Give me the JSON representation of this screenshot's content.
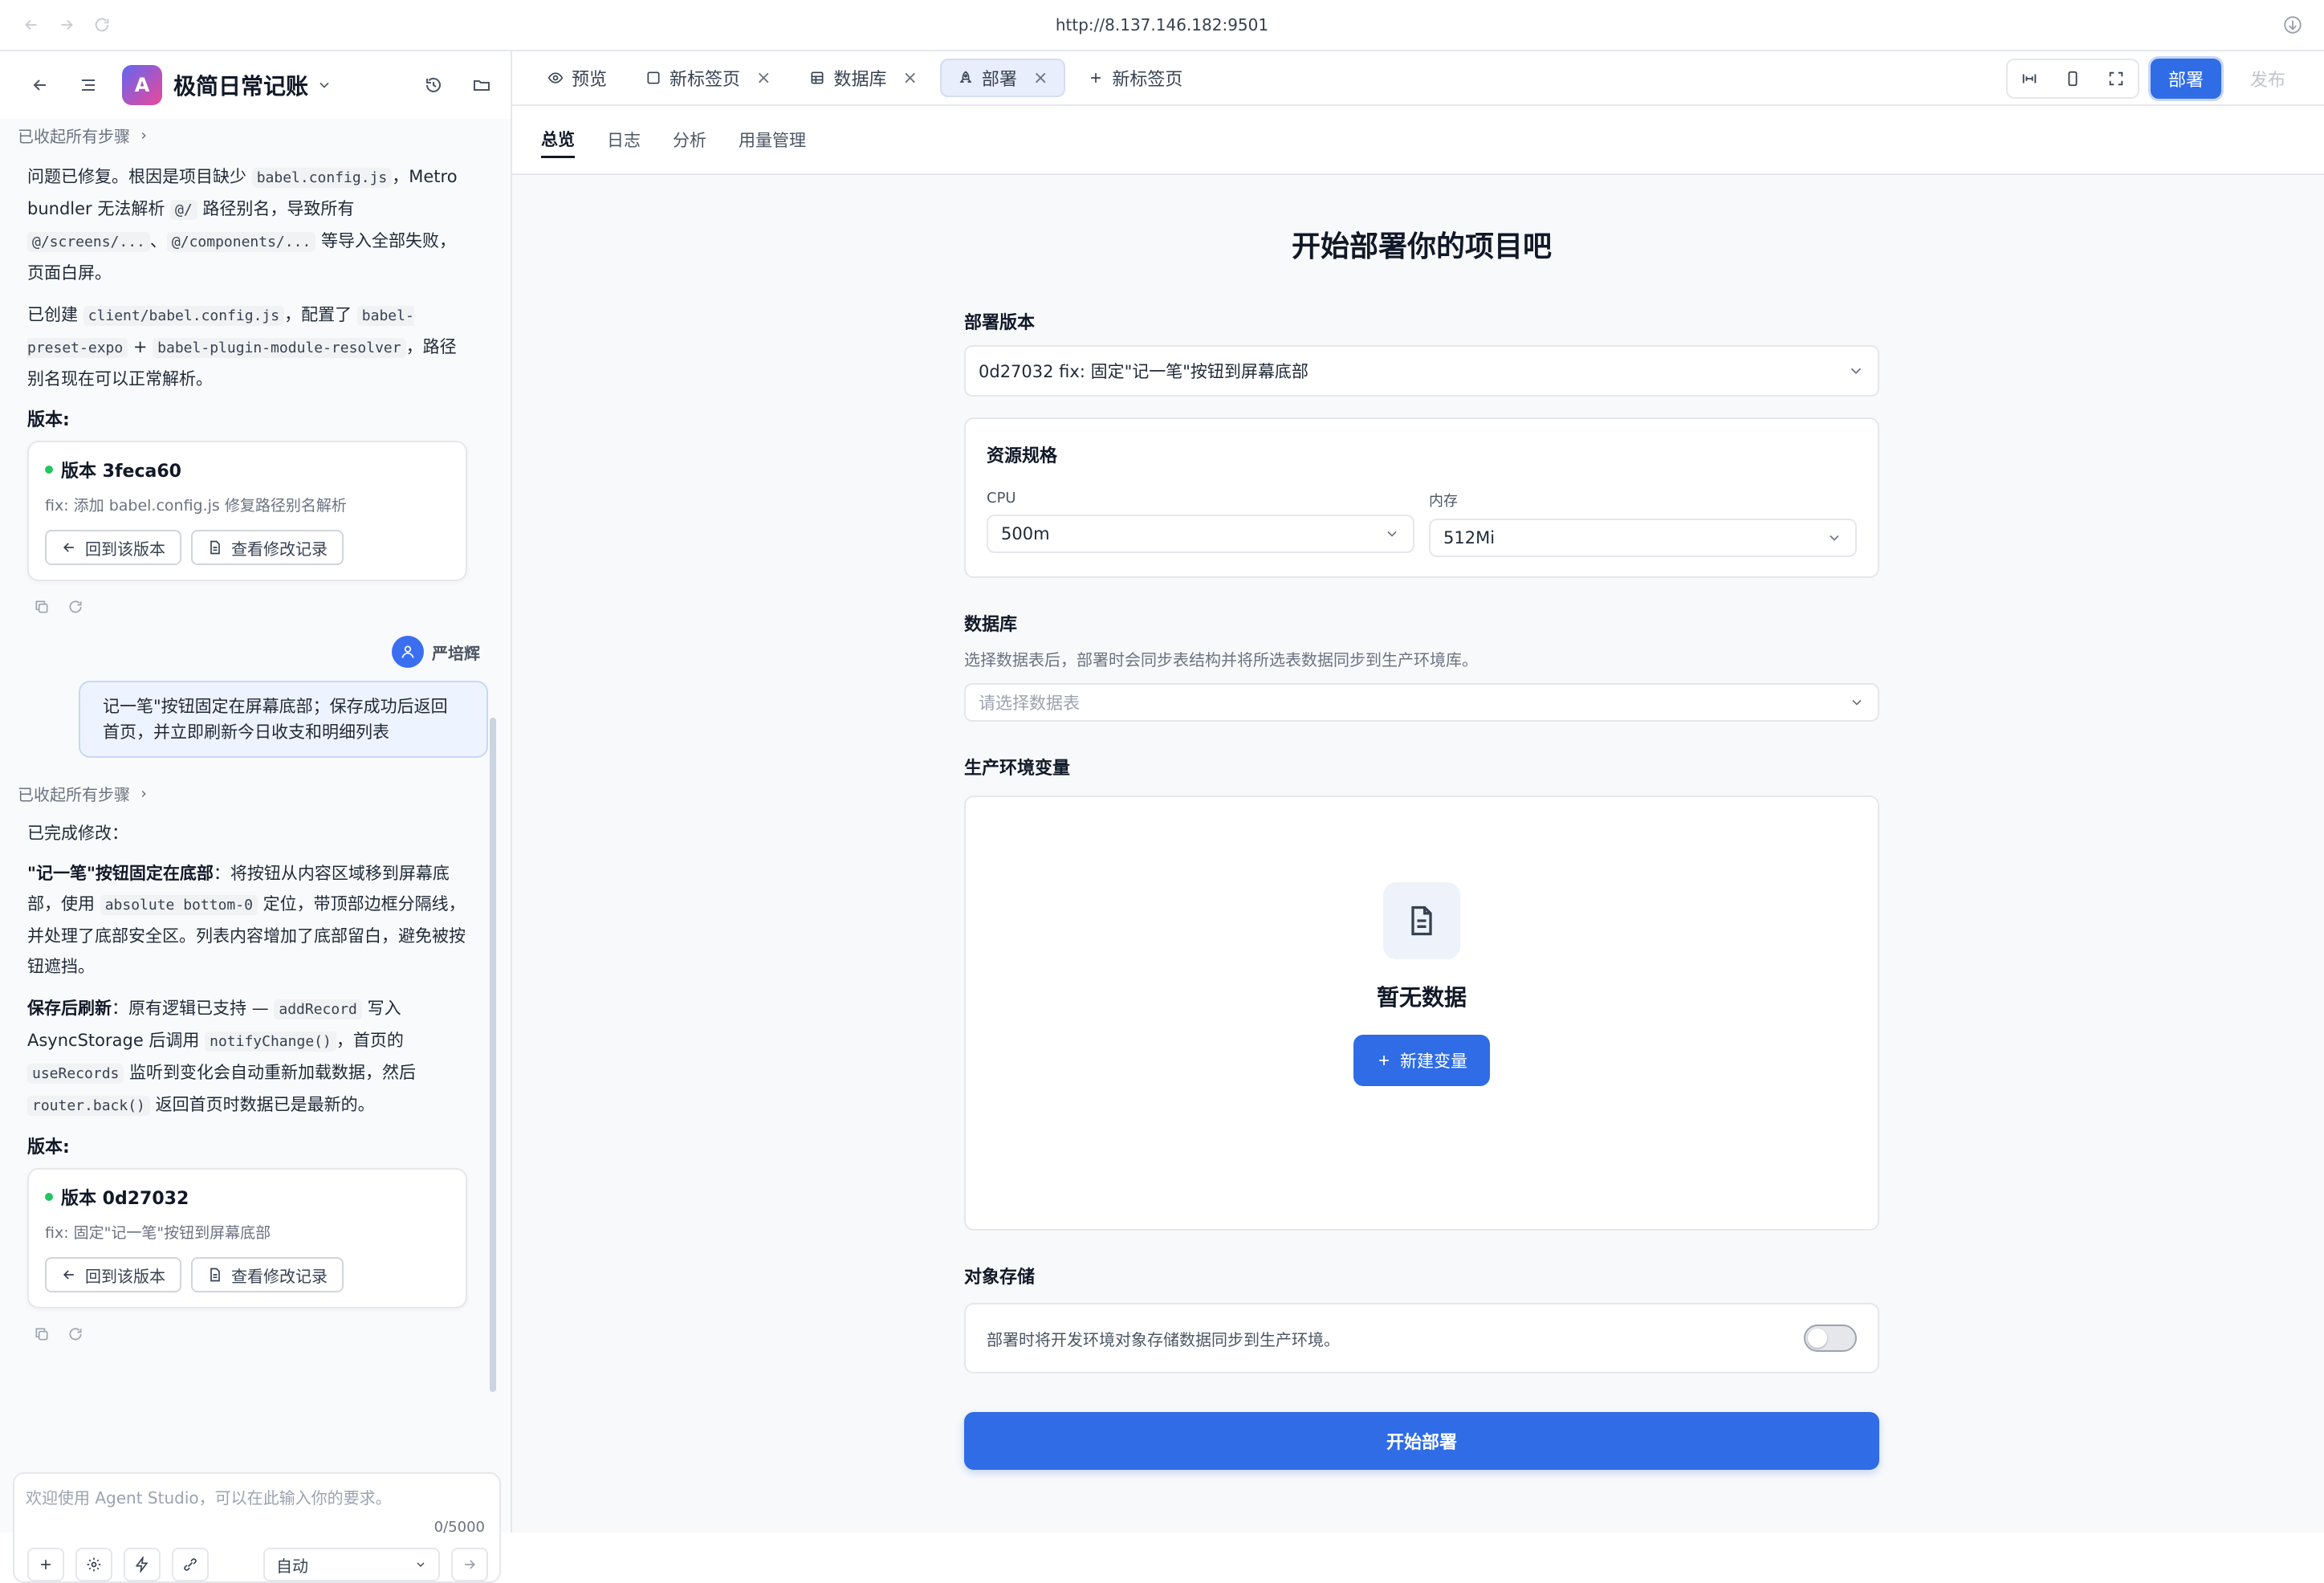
{
  "browser": {
    "url": "http://8.137.146.182:9501"
  },
  "app": {
    "title": "极简日常记账",
    "avatar_letter": "A"
  },
  "chat": {
    "collapsed_label": "已收起所有步骤",
    "msg1": {
      "p1": {
        "t1": "问题已修复。根因是项目缺少 ",
        "c1": "babel.config.js",
        "t2": "，Metro bundler 无法解析 ",
        "c2": "@/",
        "t3": " 路径别名，导致所有 ",
        "c3": "@/screens/...",
        "t4": "、",
        "c4": "@/components/...",
        "t5": " 等导入全部失败，页面白屏。"
      },
      "p2": {
        "t1": "已创建 ",
        "c1": "client/babel.config.js",
        "t2": "，配置了 ",
        "c2": "babel-preset-expo",
        "t3": " + ",
        "c3": "babel-plugin-module-resolver",
        "t4": "，路径别名现在可以正常解析。"
      },
      "version_label": "版本:",
      "version": {
        "title": "版本 3feca60",
        "desc": "fix: 添加 babel.config.js 修复路径别名解析"
      }
    },
    "version_buttons": {
      "revert": "回到该版本",
      "view": "查看修改记录"
    },
    "user": {
      "name": "严培辉",
      "message": "记一笔\"按钮固定在屏幕底部；保存成功后返回首页，并立即刷新今日收支和明细列表"
    },
    "msg2": {
      "intro": "已完成修改：",
      "p1": {
        "b": "\"记一笔\"按钮固定在底部",
        "t1": "：将按钮从内容区域移到屏幕底部，使用 ",
        "c1": "absolute bottom-0",
        "t2": " 定位，带顶部边框分隔线，并处理了底部安全区。列表内容增加了底部留白，避免被按钮遮挡。"
      },
      "p2": {
        "b": "保存后刷新",
        "t1": "：原有逻辑已支持 — ",
        "c1": "addRecord",
        "t2": " 写入 AsyncStorage 后调用 ",
        "c2": "notifyChange()",
        "t3": "，首页的 ",
        "c3": "useRecords",
        "t4": " 监听到变化会自动重新加载数据，然后 ",
        "c4": "router.back()",
        "t5": " 返回首页时数据已是最新的。"
      },
      "version_label": "版本:",
      "version": {
        "title": "版本 0d27032",
        "desc": "fix: 固定\"记一笔\"按钮到屏幕底部"
      }
    },
    "input": {
      "placeholder": "欢迎使用 Agent Studio，可以在此输入你的要求。",
      "counter": "0/5000",
      "mode": "自动"
    }
  },
  "tabs": [
    {
      "label": "预览"
    },
    {
      "label": "新标签页"
    },
    {
      "label": "数据库"
    },
    {
      "label": "部署"
    },
    {
      "label": "新标签页"
    }
  ],
  "toolbar": {
    "deploy": "部署",
    "publish": "发布"
  },
  "subtabs": [
    "总览",
    "日志",
    "分析",
    "用量管理"
  ],
  "deploy": {
    "heading": "开始部署你的项目吧",
    "version_label": "部署版本",
    "version_value": "0d27032 fix: 固定\"记一笔\"按钮到屏幕底部",
    "resources": {
      "title": "资源规格",
      "cpu_label": "CPU",
      "cpu_value": "500m",
      "mem_label": "内存",
      "mem_value": "512Mi"
    },
    "database": {
      "title": "数据库",
      "desc": "选择数据表后，部署时会同步表结构并将所选表数据同步到生产环境库。",
      "placeholder": "请选择数据表"
    },
    "env": {
      "title": "生产环境变量",
      "empty": "暂无数据",
      "add": "新建变量"
    },
    "storage": {
      "title": "对象存储",
      "desc": "部署时将开发环境对象存储数据同步到生产环境。",
      "enabled": false
    },
    "start_button": "开始部署"
  },
  "colors": {
    "primary": "#2f6ce5",
    "success": "#22c55e"
  }
}
